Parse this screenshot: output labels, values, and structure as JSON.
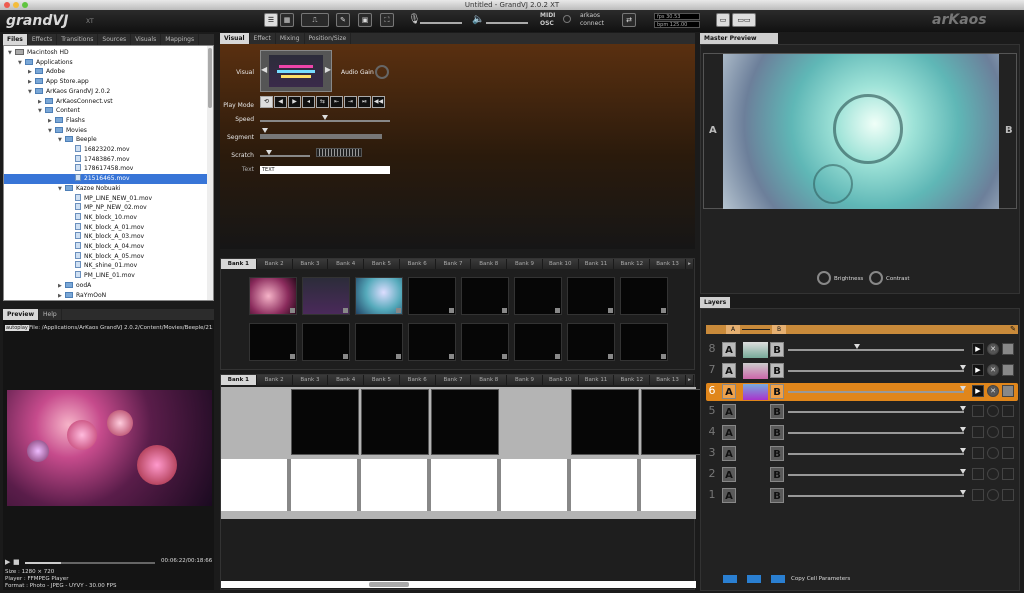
{
  "window": {
    "title": "Untitled - GrandVJ 2.0.2 XT"
  },
  "brand": {
    "logo": "grandVJ",
    "edition": "XT",
    "right_logo": "arKaos"
  },
  "toolbar": {
    "midi": "MIDI",
    "osc": "OSC",
    "connect_top": "arkaos",
    "connect_bottom": "connect",
    "fps_label": "fps 30.53",
    "bpm_label": "bpm 125.00"
  },
  "left_tabs": [
    "Files",
    "Effects",
    "Transitions",
    "Sources",
    "Visuals",
    "Mappings"
  ],
  "tree": [
    {
      "label": "Macintosh HD",
      "depth": 0,
      "kind": "hd",
      "open": true
    },
    {
      "label": "Applications",
      "depth": 1,
      "kind": "folder",
      "open": true
    },
    {
      "label": "Adobe",
      "depth": 2,
      "kind": "folder",
      "open": false
    },
    {
      "label": "App Store.app",
      "depth": 2,
      "kind": "folder",
      "open": false
    },
    {
      "label": "ArKaos GrandVJ 2.0.2",
      "depth": 2,
      "kind": "folder",
      "open": true
    },
    {
      "label": "ArKaosConnect.vst",
      "depth": 3,
      "kind": "folder",
      "open": false
    },
    {
      "label": "Content",
      "depth": 3,
      "kind": "folder",
      "open": true
    },
    {
      "label": "Flashs",
      "depth": 4,
      "kind": "folder",
      "open": false
    },
    {
      "label": "Movies",
      "depth": 4,
      "kind": "folder",
      "open": true
    },
    {
      "label": "Beeple",
      "depth": 5,
      "kind": "folder",
      "open": true
    },
    {
      "label": "16823202.mov",
      "depth": 6,
      "kind": "file"
    },
    {
      "label": "17483867.mov",
      "depth": 6,
      "kind": "file"
    },
    {
      "label": "178617458.mov",
      "depth": 6,
      "kind": "file"
    },
    {
      "label": "21516465.mov",
      "depth": 6,
      "kind": "file",
      "selected": true
    },
    {
      "label": "Kazoe Nobuaki",
      "depth": 5,
      "kind": "folder",
      "open": true
    },
    {
      "label": "MP_LINE_NEW_01.mov",
      "depth": 6,
      "kind": "file"
    },
    {
      "label": "MP_NP_NEW_02.mov",
      "depth": 6,
      "kind": "file"
    },
    {
      "label": "NK_block_10.mov",
      "depth": 6,
      "kind": "file"
    },
    {
      "label": "NK_block_A_01.mov",
      "depth": 6,
      "kind": "file"
    },
    {
      "label": "NK_block_A_03.mov",
      "depth": 6,
      "kind": "file"
    },
    {
      "label": "NK_block_A_04.mov",
      "depth": 6,
      "kind": "file"
    },
    {
      "label": "NK_block_A_05.mov",
      "depth": 6,
      "kind": "file"
    },
    {
      "label": "NK_shine_01.mov",
      "depth": 6,
      "kind": "file"
    },
    {
      "label": "PM_LINE_01.mov",
      "depth": 6,
      "kind": "file"
    },
    {
      "label": "oodA",
      "depth": 5,
      "kind": "folder",
      "open": false
    },
    {
      "label": "RaYmOoN",
      "depth": 5,
      "kind": "folder",
      "open": false
    }
  ],
  "preview": {
    "tabs": [
      "Preview",
      "Help"
    ],
    "badge": "autoplay",
    "file_path": "File: /Applications/ArKaos GrandVJ 2.0.2/Content/Movies/Beeple/21516465",
    "time": "00:06:22/00:18:66",
    "size": "Size : 1280 × 720",
    "player": "Player : FFMPEG Player",
    "format": "Format : Photo - JPEG - UYVY - 30.00 FPS",
    "progress": 0.28
  },
  "visual_panel": {
    "tabs": [
      "Visual",
      "Effect",
      "Mixing",
      "Position/Size"
    ],
    "labels": {
      "visual": "Visual",
      "audio_gain": "Audio Gain",
      "play_mode": "Play Mode",
      "speed": "Speed",
      "segment": "Segment",
      "scratch": "Scratch",
      "text": "Text"
    },
    "text_value": "TEXT",
    "speed": 0.5,
    "play_mode_icons": [
      "loop-icon",
      "reverse-icon",
      "play-icon",
      "back-icon",
      "bounce-icon",
      "step-back-icon",
      "step-fwd-icon",
      "pause-play-icon",
      "rewind-icon"
    ]
  },
  "banks_top": [
    "Bank 1",
    "Bank 2",
    "Bank 3",
    "Bank 4",
    "Bank 5",
    "Bank 6",
    "Bank 7",
    "Bank 8",
    "Bank 9",
    "Bank 10",
    "Bank 11",
    "Bank 12",
    "Bank 13"
  ],
  "banks_bottom": [
    "Bank 1",
    "Bank 2",
    "Bank 3",
    "Bank 4",
    "Bank 5",
    "Bank 6",
    "Bank 7",
    "Bank 8",
    "Bank 9",
    "Bank 10",
    "Bank 11",
    "Bank 12",
    "Bank 13"
  ],
  "master": {
    "title": "Master Preview",
    "a": "A",
    "b": "B",
    "brightness": "Brightness",
    "contrast": "Contrast"
  },
  "layers": {
    "title": "Layers",
    "rows": [
      {
        "n": "8",
        "a": "A",
        "b": "B",
        "active": false,
        "thumb": true,
        "level": 0.4
      },
      {
        "n": "7",
        "a": "A",
        "b": "B",
        "active": false,
        "thumb": true,
        "level": 1
      },
      {
        "n": "6",
        "a": "A",
        "b": "B",
        "active": true,
        "thumb": true,
        "level": 1
      },
      {
        "n": "5",
        "a": "A",
        "b": "B",
        "active": false,
        "thumb": false,
        "level": 1
      },
      {
        "n": "4",
        "a": "A",
        "b": "B",
        "active": false,
        "thumb": false,
        "level": 1
      },
      {
        "n": "3",
        "a": "A",
        "b": "B",
        "active": false,
        "thumb": false,
        "level": 1
      },
      {
        "n": "2",
        "a": "A",
        "b": "B",
        "active": false,
        "thumb": false,
        "level": 1
      },
      {
        "n": "1",
        "a": "A",
        "b": "B",
        "active": false,
        "thumb": false,
        "level": 1
      }
    ],
    "crossfader": {
      "a": "A",
      "b": "B"
    },
    "footer": "Copy Cell Parameters"
  },
  "colors": {
    "accent": "#e0861b",
    "selection": "#3875d7"
  }
}
